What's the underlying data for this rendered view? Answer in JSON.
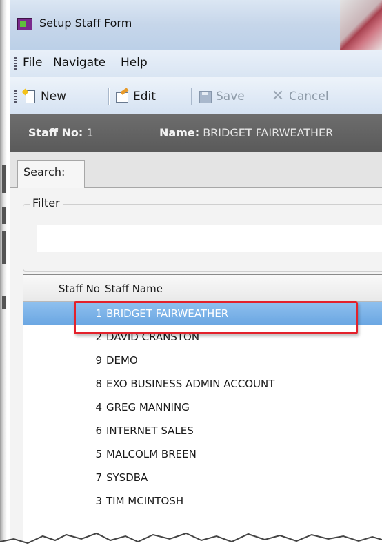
{
  "window": {
    "title": "Setup Staff Form",
    "title_icon": "app-form-icon"
  },
  "menu": {
    "items": [
      "File",
      "Navigate",
      "Help"
    ]
  },
  "toolbar": {
    "new_label": "New",
    "edit_label": "Edit",
    "save_label": "Save",
    "cancel_label": "Cancel",
    "save_enabled": false,
    "cancel_enabled": false
  },
  "record_header": {
    "staff_no_key": "Staff No:",
    "staff_no_value": "1",
    "name_key": "Name:",
    "name_value": "BRIDGET FAIRWEATHER"
  },
  "tabs": {
    "search": "Search:"
  },
  "filter": {
    "legend": "Filter",
    "value": ""
  },
  "grid": {
    "columns": [
      "Staff No",
      "Staff Name"
    ],
    "rows": [
      {
        "no": "1",
        "name": "BRIDGET FAIRWEATHER",
        "selected": true
      },
      {
        "no": "2",
        "name": "DAVID CRANSTON"
      },
      {
        "no": "9",
        "name": "DEMO"
      },
      {
        "no": "8",
        "name": "EXO BUSINESS ADMIN ACCOUNT"
      },
      {
        "no": "4",
        "name": "GREG MANNING"
      },
      {
        "no": "6",
        "name": "INTERNET SALES"
      },
      {
        "no": "5",
        "name": "MALCOLM BREEN"
      },
      {
        "no": "7",
        "name": "SYSDBA"
      },
      {
        "no": "3",
        "name": "TIM MCINTOSH"
      }
    ]
  },
  "colors": {
    "selection": "#6aa6e2",
    "highlight_box": "#e3212b",
    "header_strip": "#5a5a5a",
    "toolbar": "#d5e2f2"
  }
}
